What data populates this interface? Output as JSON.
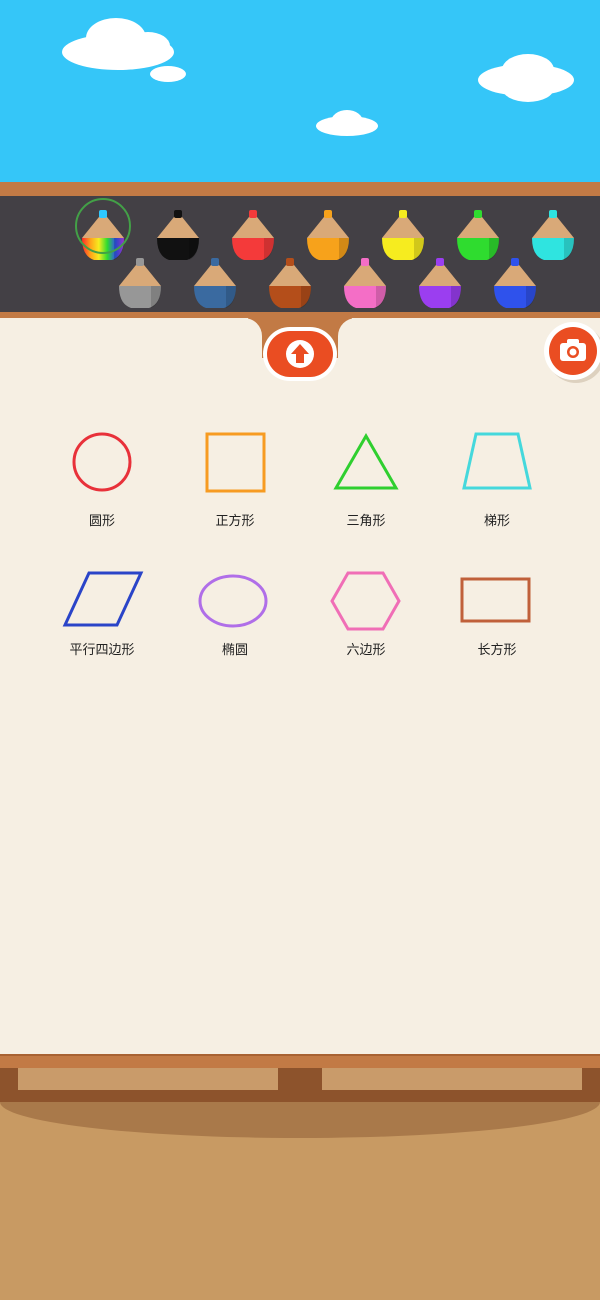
{
  "colors": {
    "sky": "#35c6f8",
    "paper": "#f6efe3",
    "accent": "#ea4d22",
    "wood": "#c27a45",
    "tray": "#434045"
  },
  "toolbar": {
    "upload_icon": "arrow-up-circle-icon",
    "camera_icon": "camera-icon"
  },
  "pencils": [
    {
      "name": "rainbow",
      "color": "rainbow",
      "selected": true
    },
    {
      "name": "black",
      "color": "#111111",
      "selected": false
    },
    {
      "name": "red",
      "color": "#f43a3a",
      "selected": false
    },
    {
      "name": "orange",
      "color": "#f7a21b",
      "selected": false
    },
    {
      "name": "yellow",
      "color": "#f6ec1f",
      "selected": false
    },
    {
      "name": "green",
      "color": "#2fdc2f",
      "selected": false
    },
    {
      "name": "cyan",
      "color": "#2fe4e0",
      "selected": false
    },
    {
      "name": "gray",
      "color": "#979797",
      "selected": false
    },
    {
      "name": "steel-blue",
      "color": "#3a6aa0",
      "selected": false
    },
    {
      "name": "brown",
      "color": "#b44e1a",
      "selected": false
    },
    {
      "name": "pink",
      "color": "#f46ec6",
      "selected": false
    },
    {
      "name": "purple",
      "color": "#9b3ef0",
      "selected": false
    },
    {
      "name": "blue",
      "color": "#2f52ec",
      "selected": false
    }
  ],
  "shapes": [
    {
      "id": "circle",
      "label": "圆形",
      "color": "#e8313a"
    },
    {
      "id": "square",
      "label": "正方形",
      "color": "#f79b21"
    },
    {
      "id": "triangle",
      "label": "三角形",
      "color": "#2fcf2f"
    },
    {
      "id": "trapezoid",
      "label": "梯形",
      "color": "#45d8dc"
    },
    {
      "id": "parallelogram",
      "label": "平行四边形",
      "color": "#2a44c8"
    },
    {
      "id": "ellipse",
      "label": "椭圆",
      "color": "#b06ee8"
    },
    {
      "id": "hexagon",
      "label": "六边形",
      "color": "#f06eb6"
    },
    {
      "id": "rectangle",
      "label": "长方形",
      "color": "#c0603a"
    }
  ]
}
